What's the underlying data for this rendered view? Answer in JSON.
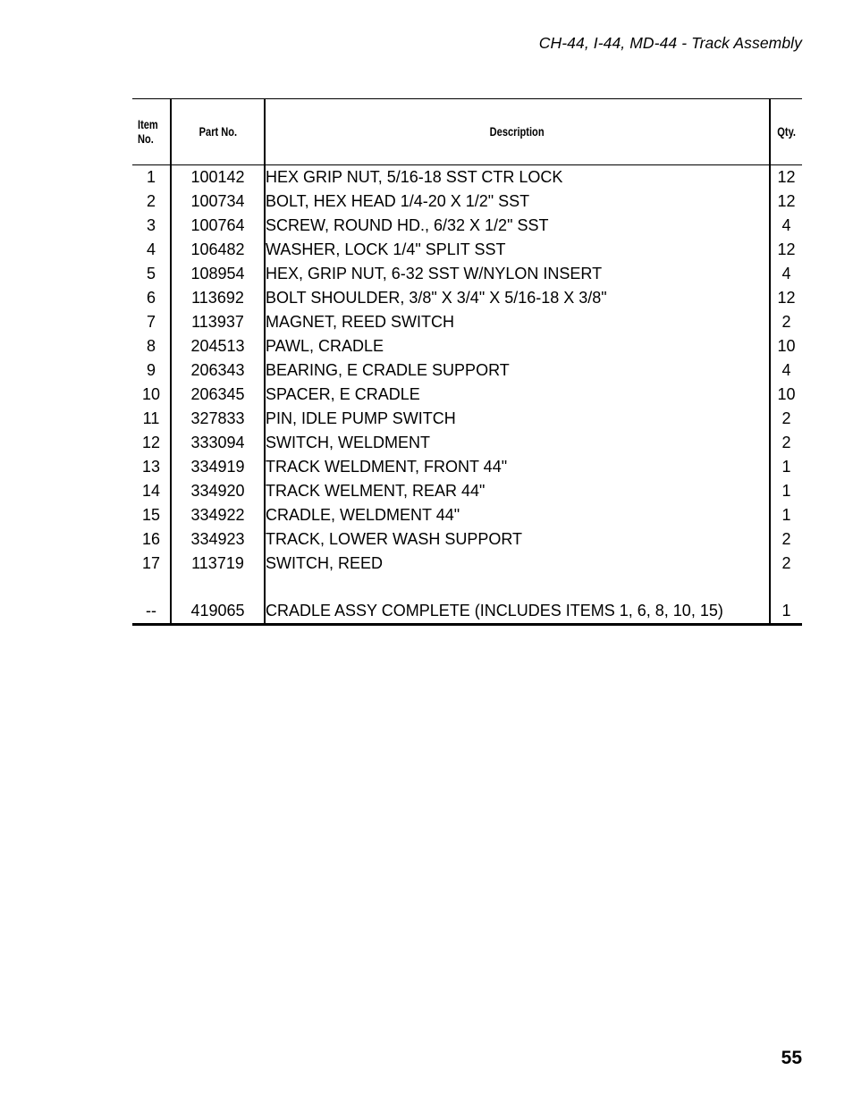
{
  "header": {
    "running_title": "CH-44, I-44, MD-44 - Track Assembly"
  },
  "table": {
    "columns": {
      "item_no_line1": "Item",
      "item_no_line2": "No.",
      "part_no": "Part No.",
      "description": "Description",
      "qty": "Qty."
    },
    "rows": [
      {
        "item": "1",
        "part": "100142",
        "desc": "HEX GRIP NUT, 5/16-18 SST CTR LOCK",
        "qty": "12"
      },
      {
        "item": "2",
        "part": "100734",
        "desc": "BOLT, HEX HEAD 1/4-20 X 1/2\" SST",
        "qty": "12"
      },
      {
        "item": "3",
        "part": "100764",
        "desc": "SCREW, ROUND HD., 6/32 X 1/2\" SST",
        "qty": "4"
      },
      {
        "item": "4",
        "part": "106482",
        "desc": "WASHER, LOCK 1/4\" SPLIT SST",
        "qty": "12"
      },
      {
        "item": "5",
        "part": "108954",
        "desc": "HEX, GRIP NUT, 6-32 SST W/NYLON INSERT",
        "qty": "4"
      },
      {
        "item": "6",
        "part": "113692",
        "desc": "BOLT SHOULDER, 3/8\" X 3/4\" X 5/16-18 X 3/8\"",
        "qty": "12"
      },
      {
        "item": "7",
        "part": "113937",
        "desc": "MAGNET, REED SWITCH",
        "qty": "2"
      },
      {
        "item": "8",
        "part": "204513",
        "desc": "PAWL, CRADLE",
        "qty": "10"
      },
      {
        "item": "9",
        "part": "206343",
        "desc": "BEARING, E CRADLE SUPPORT",
        "qty": "4"
      },
      {
        "item": "10",
        "part": "206345",
        "desc": "SPACER, E CRADLE",
        "qty": "10"
      },
      {
        "item": "11",
        "part": "327833",
        "desc": "PIN, IDLE PUMP SWITCH",
        "qty": "2"
      },
      {
        "item": "12",
        "part": "333094",
        "desc": "SWITCH, WELDMENT",
        "qty": "2"
      },
      {
        "item": "13",
        "part": "334919",
        "desc": "TRACK WELDMENT, FRONT 44\"",
        "qty": "1"
      },
      {
        "item": "14",
        "part": "334920",
        "desc": "TRACK WELMENT, REAR 44\"",
        "qty": "1"
      },
      {
        "item": "15",
        "part": "334922",
        "desc": "CRADLE, WELDMENT 44\"",
        "qty": "1"
      },
      {
        "item": "16",
        "part": "334923",
        "desc": "TRACK, LOWER WASH SUPPORT",
        "qty": "2"
      },
      {
        "item": "17",
        "part": "113719",
        "desc": "SWITCH, REED",
        "qty": "2"
      },
      {
        "item": "--",
        "part": "419065",
        "desc": "CRADLE ASSY COMPLETE (INCLUDES ITEMS 1, 6, 8, 10, 15)",
        "qty": "1",
        "gap_before": true
      }
    ]
  },
  "footer": {
    "page_number": "55"
  }
}
